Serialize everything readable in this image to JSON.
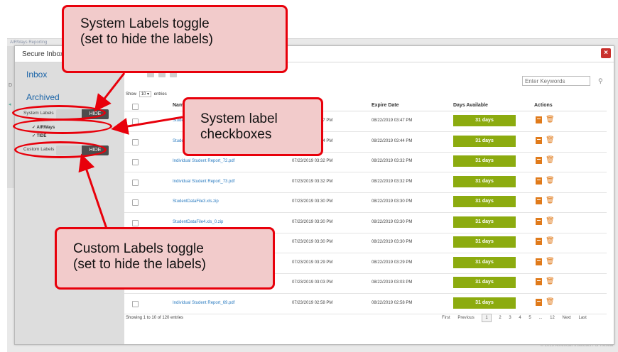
{
  "background_app": {
    "title": "AIRWays Reporting",
    "side_letter": "D",
    "copyright": "© 2019 American Institutes For Resear"
  },
  "modal": {
    "title": "Secure Inbox",
    "close_label": "×",
    "sidebar": {
      "inbox": "Inbox",
      "archived": "Archived",
      "system_labels": {
        "label": "System Labels",
        "state": "HIDE"
      },
      "system_checkboxes": [
        {
          "label": "AIRWays"
        },
        {
          "label": "TIDE"
        }
      ],
      "custom_labels": {
        "label": "Custom Labels",
        "state": "HIDE"
      }
    },
    "search": {
      "placeholder": "Enter Keywords"
    },
    "show_entries": {
      "prefix": "Show",
      "value": "10",
      "suffix": "entries"
    },
    "columns": {
      "name": "Name",
      "expire": "Expire Date",
      "days": "Days Available",
      "actions": "Actions"
    },
    "rows": [
      {
        "name": "Student Data",
        "date1": "07/23/2019 03:47 PM",
        "date2": "08/22/2019 03:47 PM",
        "days": "31 days"
      },
      {
        "name": "Student Data",
        "date1": "07/23/2019 03:44 PM",
        "date2": "08/22/2019 03:44 PM",
        "days": "31 days"
      },
      {
        "name": "Individual Student Report_72.pdf",
        "date1": "07/23/2019 03:32 PM",
        "date2": "08/22/2019 03:32 PM",
        "days": "31 days"
      },
      {
        "name": "Individual Student Report_73.pdf",
        "date1": "07/23/2019 03:32 PM",
        "date2": "08/22/2019 03:32 PM",
        "days": "31 days"
      },
      {
        "name": "StudentDataFile3.xls.zip",
        "date1": "07/23/2019 03:30 PM",
        "date2": "08/22/2019 03:30 PM",
        "days": "31 days"
      },
      {
        "name": "StudentDataFile4.xls_0.zip",
        "date1": "07/23/2019 03:30 PM",
        "date2": "08/22/2019 03:30 PM",
        "days": "31 days"
      },
      {
        "name": "",
        "date1": "07/23/2019 03:30 PM",
        "date2": "08/22/2019 03:30 PM",
        "days": "31 days"
      },
      {
        "name": "",
        "date1": "07/23/2019 03:29 PM",
        "date2": "08/22/2019 03:29 PM",
        "days": "31 days"
      },
      {
        "name": "",
        "date1": "07/23/2019 03:03 PM",
        "date2": "08/22/2019 03:03 PM",
        "days": "31 days"
      },
      {
        "name": "Individual Student Report_69.pdf",
        "date1": "07/23/2019 02:58 PM",
        "date2": "08/22/2019 02:58 PM",
        "days": "31 days"
      }
    ],
    "footer": {
      "showing": "Showing 1 to 10 of 120 entries",
      "pager": {
        "first": "First",
        "previous": "Previous",
        "pages": [
          "1",
          "2",
          "3",
          "4",
          "5",
          "...",
          "12"
        ],
        "next": "Next",
        "last": "Last"
      }
    }
  },
  "callouts": {
    "system_labels": "System Labels toggle\n(set to hide the labels)",
    "checkboxes": "System label\ncheckboxes",
    "custom_labels": "Custom Labels toggle\n(set to hide the labels)"
  },
  "colors": {
    "accent_red": "#e8000b",
    "callout_fill": "#f2cbcb",
    "days_green": "#8cab0f",
    "action_orange": "#e07a1a",
    "link_blue": "#2a7bc0"
  }
}
